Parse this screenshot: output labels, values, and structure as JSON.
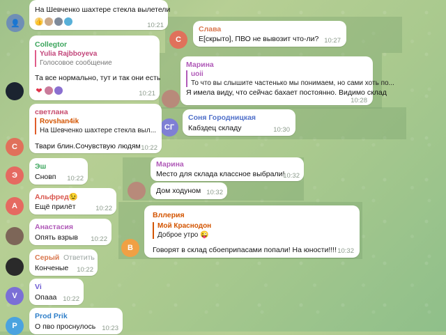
{
  "colors": {
    "time": "#8b9a8b",
    "avatar_s": "#e0715b",
    "avatar_sg": "#7f7fd5",
    "avatar_e": "#e56a61",
    "avatar_a": "#e56a61",
    "avatar_v": "#7b6fd6",
    "avatar_p": "#4aa3df",
    "avatar_b": "#f0a044"
  },
  "messages": [
    {
      "text": "На Шевченко шахтере стекла вылетели",
      "time": "10:21",
      "reactions": [
        "thumbs-up-icon",
        "avatar-icon",
        "avatar-icon",
        "avatar-icon"
      ]
    },
    {
      "sender": "Слава",
      "text": "Е[скрыто], ПВО не вывозит что-ли?",
      "time": "10:27",
      "avatar": "С"
    },
    {
      "sender": "Collegtor",
      "quote_name": "Yulia Rajbboyeva",
      "quote_text": "Голосовое сообщение",
      "text": "Та все нормально, тут и так они есть",
      "time": "10:21",
      "reactions": [
        "heart-icon",
        "avatar-icon",
        "avatar-icon"
      ]
    },
    {
      "sender": "Марина",
      "quote_name": "uoii",
      "quote_text": "То что вы слышите частенько мы понимаем, но сами хоть по...",
      "text": "Я имела виду, что сейчас бахает постоянно. Видимо склад",
      "time": "10:28"
    },
    {
      "sender": "Соня Городницкая",
      "text": "Кабздец складу",
      "time": "10:30",
      "avatar": "СГ"
    },
    {
      "sender": "светлана",
      "quote_name": "Rovshan4ik",
      "quote_text": "На Шевченко шахтере стекла выл...",
      "text": "Твари блин.Сочувствую людям",
      "time": "10:22",
      "avatar": "С"
    },
    {
      "sender": "Эш",
      "text": "Сновп",
      "time": "10:22",
      "avatar": "Э"
    },
    {
      "sender": "Марина",
      "text": "Место для склада классное выбрали!",
      "time": "10:32"
    },
    {
      "text": "Дом ходуном",
      "time": "10:32"
    },
    {
      "sender": "Альфред😉",
      "text": "Ещё прилёт",
      "time": "10:22",
      "avatar": "А"
    },
    {
      "sender": "Вллерия",
      "quote_name": "Мой Краснодон",
      "quote_text": "Доброе утро 😜",
      "text": "Говорят в склад сбоеприпасами попали! На юности!!!!",
      "time": "10:32",
      "avatar": "В"
    },
    {
      "sender": "Анастасия",
      "text": "Опять взрыв",
      "time": "10:22"
    },
    {
      "sender": "Серый",
      "reply_label": "Ответить",
      "text": "Конченые",
      "time": "10:22"
    },
    {
      "sender": "Vi",
      "text": "Опааа",
      "time": "10:22",
      "avatar": "V"
    },
    {
      "sender": "Prod Prik",
      "text": "О пво проснулось",
      "time": "10:23",
      "avatar": "P"
    }
  ]
}
